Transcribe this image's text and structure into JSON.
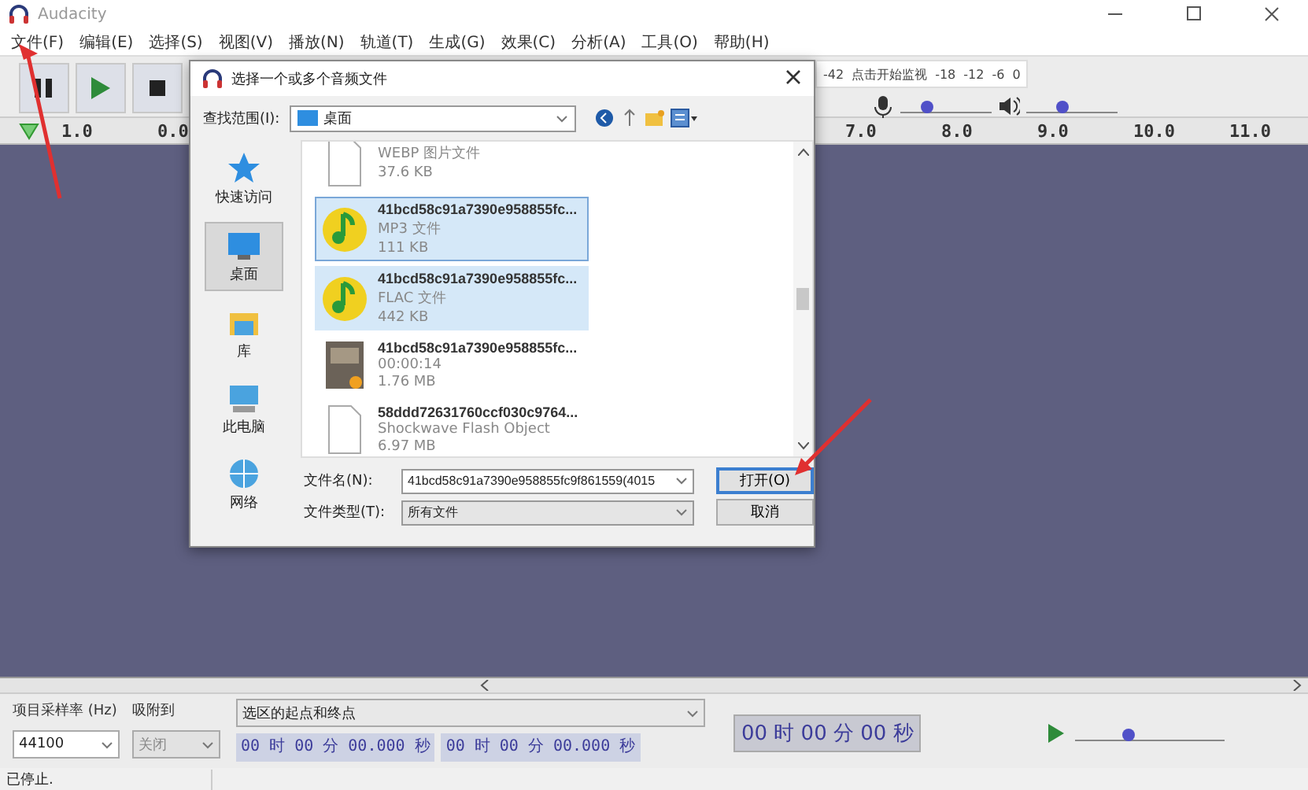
{
  "window": {
    "title": "Audacity"
  },
  "menu": [
    "文件(F)",
    "编辑(E)",
    "选择(S)",
    "视图(V)",
    "播放(N)",
    "轨道(T)",
    "生成(G)",
    "效果(C)",
    "分析(A)",
    "工具(O)",
    "帮助(H)"
  ],
  "transport": [
    {
      "kind": "pause"
    },
    {
      "kind": "play"
    },
    {
      "kind": "stop"
    }
  ],
  "meter": {
    "labels": [
      "-42",
      "点击开始监视",
      "-18",
      "-12",
      "-6",
      "0"
    ]
  },
  "mixer": [
    {
      "kind": "mic",
      "level": 0.3
    },
    {
      "kind": "speaker",
      "level": 0.4
    }
  ],
  "ruler": [
    "1.0",
    "0.0",
    "7.0",
    "8.0",
    "9.0",
    "10.0",
    "11.0"
  ],
  "dialog": {
    "title": "选择一个或多个音频文件",
    "look_in_label": "查找范围(I):",
    "look_in": "桌面",
    "places": [
      {
        "kind": "star",
        "label": "快速访问",
        "selected": false
      },
      {
        "kind": "desktop",
        "label": "桌面",
        "selected": true
      },
      {
        "kind": "library",
        "label": "库",
        "selected": false
      },
      {
        "kind": "computer",
        "label": "此电脑",
        "selected": false
      },
      {
        "kind": "network",
        "label": "网络",
        "selected": false
      }
    ],
    "files": [
      {
        "kind": "document",
        "type": "WEBP 图片文件",
        "size": "37.6 KB",
        "selected": false
      },
      {
        "kind": "music",
        "name": "41bcd58c91a7390e958855fc...",
        "type": "MP3 文件",
        "size": "111 KB",
        "selected": true
      },
      {
        "kind": "music",
        "name": "41bcd58c91a7390e958855fc...",
        "type": "FLAC 文件",
        "size": "442 KB",
        "selected": true
      },
      {
        "kind": "video",
        "name": "41bcd58c91a7390e958855fc...",
        "type": "00:00:14",
        "size": "1.76 MB",
        "selected": false
      },
      {
        "kind": "document",
        "name": "58ddd72631760ccf030c9764...",
        "type": "Shockwave Flash Object",
        "size": "6.97 MB",
        "selected": false
      }
    ],
    "file_name_label": "文件名(N):",
    "file_name": "41bcd58c91a7390e958855fc9f861559(4015",
    "file_type_label": "文件类型(T):",
    "file_type": "所有文件",
    "buttons": [
      {
        "label": "打开(O)",
        "default": true
      },
      {
        "label": "取消",
        "default": false
      }
    ]
  },
  "selection_toolbar": {
    "rate_label": "项目采样率 (Hz)",
    "snap_label": "吸附到",
    "range_label": "选区的起点和终点",
    "rate": "44100",
    "snap": "关闭",
    "snap_disabled": true,
    "start": "00 时 00 分 00.000 秒",
    "end": "00 时 00 分 00.000 秒"
  },
  "time_display": "00 时 00 分 00 秒",
  "play_speed": {
    "level": 0.35
  },
  "status": "已停止."
}
